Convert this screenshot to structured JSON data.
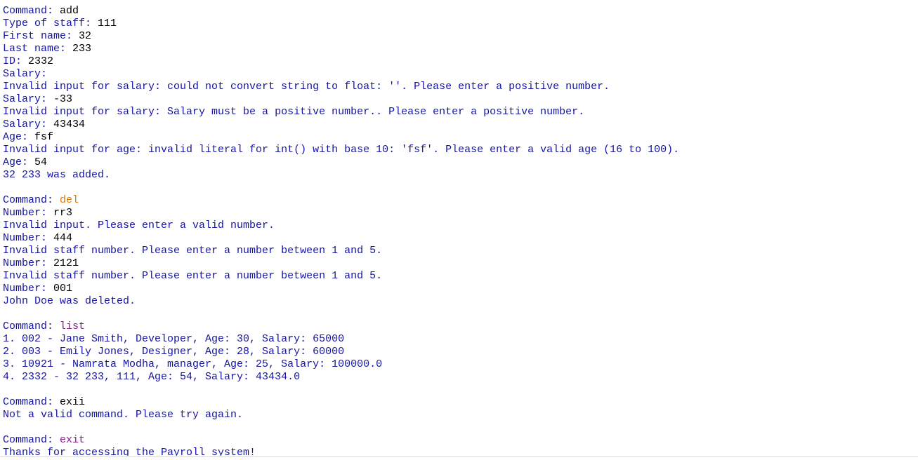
{
  "colors": {
    "output": "#1515a3",
    "input_default": "#000000",
    "input_del": "#e07a00",
    "input_list": "#8b1c8b",
    "input_exit": "#8b1c8b"
  },
  "lines": [
    {
      "prompt": "Command: ",
      "input": "add",
      "input_color": "#000000"
    },
    {
      "prompt": "Type of staff: ",
      "input": "111",
      "input_color": "#000000"
    },
    {
      "prompt": "First name: ",
      "input": "32",
      "input_color": "#000000"
    },
    {
      "prompt": "Last name: ",
      "input": "233",
      "input_color": "#000000"
    },
    {
      "prompt": "ID: ",
      "input": "2332",
      "input_color": "#000000"
    },
    {
      "prompt": "Salary:",
      "input": "",
      "input_color": "#000000"
    },
    {
      "output": "Invalid input for salary: could not convert string to float: ''. Please enter a positive number."
    },
    {
      "prompt": "Salary: ",
      "input": "-33",
      "input_color": "#000000"
    },
    {
      "output": "Invalid input for salary: Salary must be a positive number.. Please enter a positive number."
    },
    {
      "prompt": "Salary: ",
      "input": "43434",
      "input_color": "#000000"
    },
    {
      "prompt": "Age: ",
      "input": "fsf",
      "input_color": "#000000"
    },
    {
      "output": "Invalid input for age: invalid literal for int() with base 10: 'fsf'. Please enter a valid age (16 to 100)."
    },
    {
      "prompt": "Age: ",
      "input": "54",
      "input_color": "#000000"
    },
    {
      "output": "32 233 was added."
    },
    {
      "blank": true
    },
    {
      "prompt": "Command: ",
      "input": "del",
      "input_color": "#e07a00"
    },
    {
      "prompt": "Number: ",
      "input": "rr3",
      "input_color": "#000000"
    },
    {
      "output": "Invalid input. Please enter a valid number."
    },
    {
      "prompt": "Number: ",
      "input": "444",
      "input_color": "#000000"
    },
    {
      "output": "Invalid staff number. Please enter a number between 1 and 5."
    },
    {
      "prompt": "Number: ",
      "input": "2121",
      "input_color": "#000000"
    },
    {
      "output": "Invalid staff number. Please enter a number between 1 and 5."
    },
    {
      "prompt": "Number: ",
      "input": "001",
      "input_color": "#000000"
    },
    {
      "output": "John Doe was deleted."
    },
    {
      "blank": true
    },
    {
      "prompt": "Command: ",
      "input": "list",
      "input_color": "#8b1c8b"
    },
    {
      "output": "1. 002 - Jane Smith, Developer, Age: 30, Salary: 65000"
    },
    {
      "output": "2. 003 - Emily Jones, Designer, Age: 28, Salary: 60000"
    },
    {
      "output": "3. 10921 - Namrata Modha, manager, Age: 25, Salary: 100000.0"
    },
    {
      "output": "4. 2332 - 32 233, 111, Age: 54, Salary: 43434.0"
    },
    {
      "blank": true
    },
    {
      "prompt": "Command: ",
      "input": "exii",
      "input_color": "#000000"
    },
    {
      "output": "Not a valid command. Please try again."
    },
    {
      "blank": true
    },
    {
      "prompt": "Command: ",
      "input": "exit",
      "input_color": "#8b1c8b"
    },
    {
      "output": "Thanks for accessing the Payroll system!"
    }
  ]
}
